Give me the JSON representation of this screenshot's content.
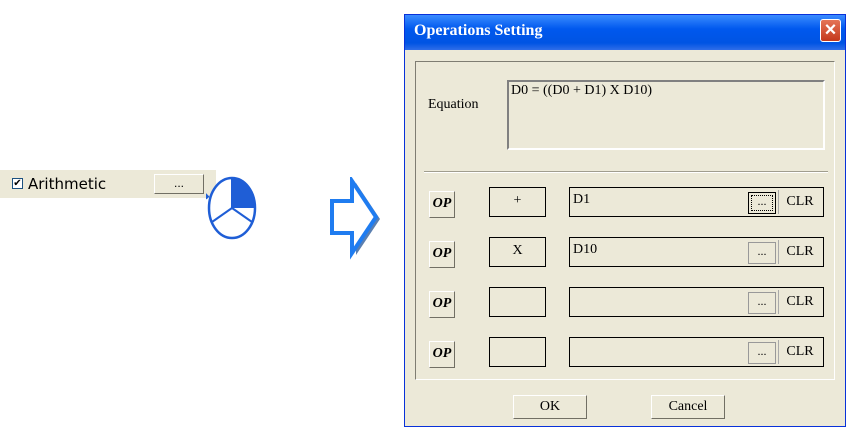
{
  "snippet": {
    "checkbox_mark": "✔",
    "checkbox_label": "Arithmetic",
    "browse_label": "..."
  },
  "dialog": {
    "title": "Operations Setting",
    "equation_label": "Equation",
    "equation_text": "D0 = ((D0 + D1) X D10)",
    "rows": [
      {
        "op_button": "OP",
        "operator": "+",
        "value": "D1",
        "browse": "...",
        "clear": "CLR"
      },
      {
        "op_button": "OP",
        "operator": "X",
        "value": "D10",
        "browse": "...",
        "clear": "CLR"
      },
      {
        "op_button": "OP",
        "operator": "",
        "value": "",
        "browse": "...",
        "clear": "CLR"
      },
      {
        "op_button": "OP",
        "operator": "",
        "value": "",
        "browse": "...",
        "clear": "CLR"
      }
    ],
    "ok_label": "OK",
    "cancel_label": "Cancel"
  },
  "colors": {
    "titlebar": "#0054e3",
    "arrow": "#1f7cf0",
    "face": "#ece9d8"
  }
}
